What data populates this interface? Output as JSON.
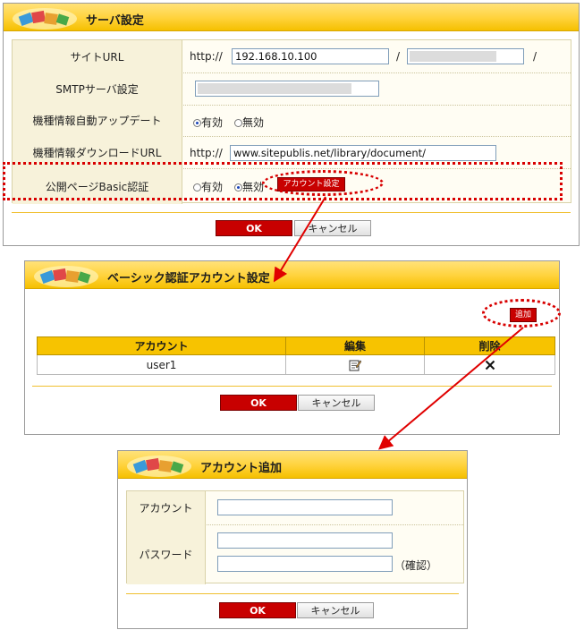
{
  "server_panel": {
    "title": "サーバ設定",
    "site_url": {
      "label": "サイトURL",
      "prefix": "http://",
      "host_value": "192.168.10.100",
      "separator": "/",
      "trailing": "/"
    },
    "smtp": {
      "label": "SMTPサーバ設定"
    },
    "auto_update": {
      "label": "機種情報自動アップデート",
      "option_on": "有効",
      "option_off": "無効",
      "selected": "有効"
    },
    "download_url": {
      "label": "機種情報ダウンロードURL",
      "prefix": "http://",
      "value": "www.sitepublis.net/library/document/"
    },
    "basic_auth": {
      "label": "公開ページBasic認証",
      "option_on": "有効",
      "option_off": "無効",
      "selected": "無効",
      "account_button": "アカウント設定"
    },
    "ok_label": "OK",
    "cancel_label": "キャンセル"
  },
  "basic_panel": {
    "title": "ベーシック認証アカウント設定",
    "add_button": "追加",
    "columns": [
      "アカウント",
      "編集",
      "削除"
    ],
    "rows": [
      {
        "account": "user1"
      }
    ],
    "ok_label": "OK",
    "cancel_label": "キャンセル"
  },
  "add_panel": {
    "title": "アカウント追加",
    "account_label": "アカウント",
    "password_label": "パスワード",
    "confirm_label": "（確認）",
    "ok_label": "OK",
    "cancel_label": "キャンセル"
  },
  "colors": {
    "accent_red": "#c80000",
    "title_yellow": "#ffd23a",
    "annotation_red": "#d80000"
  },
  "icons": [
    "app-logo-icon",
    "edit-icon",
    "delete-icon",
    "arrow-icon"
  ]
}
